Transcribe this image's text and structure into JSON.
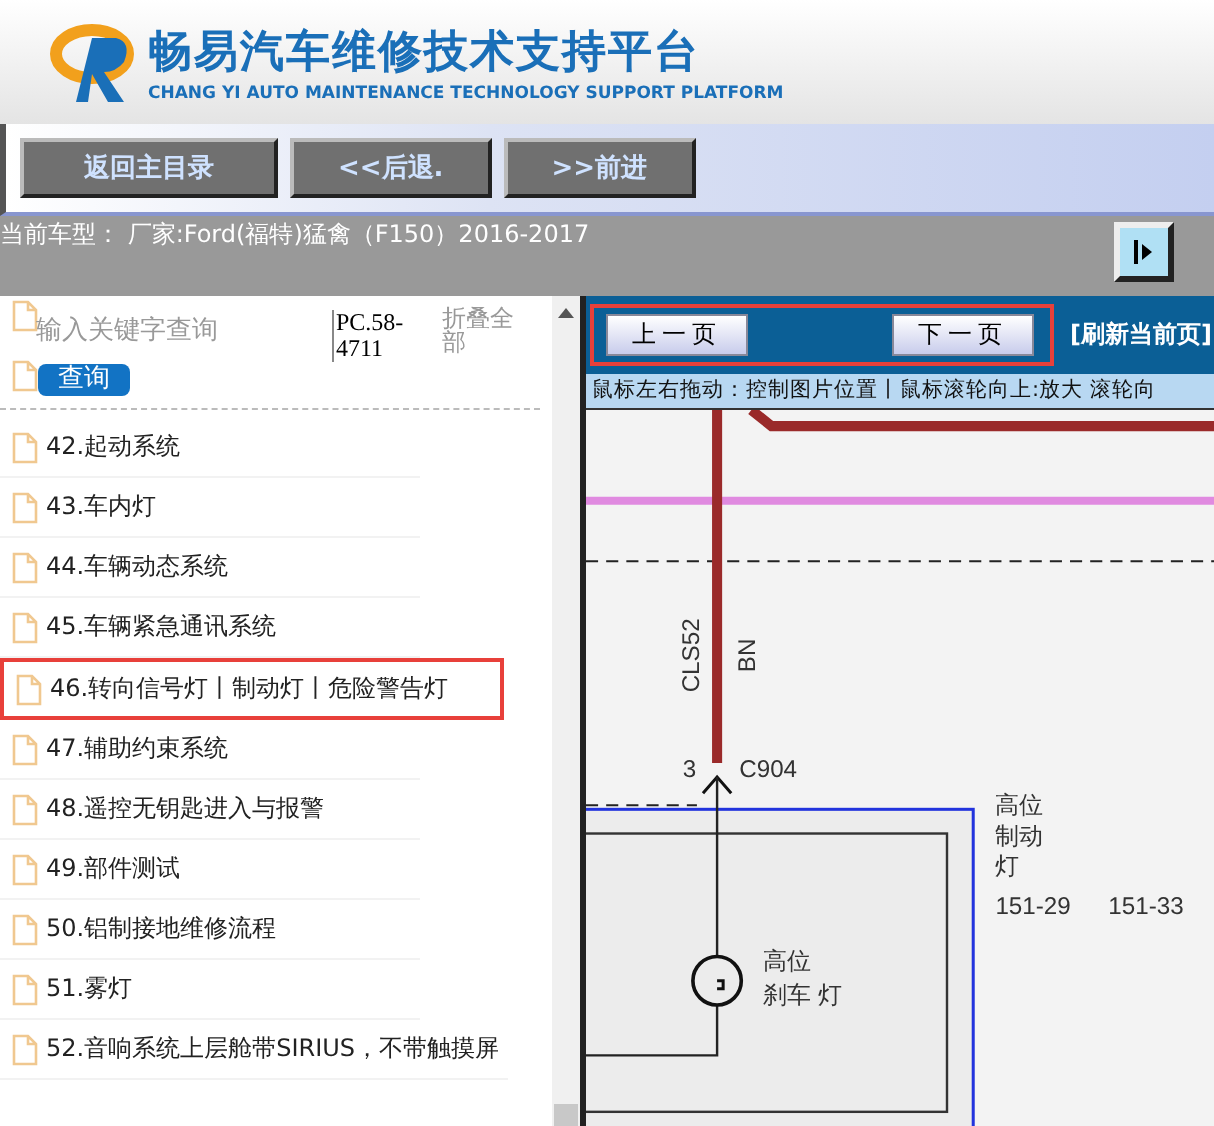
{
  "header": {
    "title": "畅易汽车维修技术支持平台",
    "subtitle": "CHANG YI AUTO MAINTENANCE TECHNOLOGY SUPPORT PLATFORM"
  },
  "nav_buttons": [
    "返回主目录",
    "<<后退.",
    ">>前进"
  ],
  "model_bar": {
    "text": "当前车型： 厂家:Ford(福特)猛禽（F150）2016-2017"
  },
  "sidebar": {
    "search": {
      "placeholder": "输入关键字查询",
      "button": "查询"
    },
    "code": "PC.58-4711",
    "collapse": "折叠全部",
    "items": [
      {
        "label": "42.起动系统",
        "highlighted": false
      },
      {
        "label": "43.车内灯",
        "highlighted": false
      },
      {
        "label": "44.车辆动态系统",
        "highlighted": false
      },
      {
        "label": "45.车辆紧急通讯系统",
        "highlighted": false
      },
      {
        "label": "46.转向信号灯丨制动灯丨危险警告灯",
        "highlighted": true
      },
      {
        "label": "47.辅助约束系统",
        "highlighted": false
      },
      {
        "label": "48.遥控无钥匙进入与报警",
        "highlighted": false
      },
      {
        "label": "49.部件测试",
        "highlighted": false
      },
      {
        "label": "50.铝制接地维修流程",
        "highlighted": false
      },
      {
        "label": "51.雾灯",
        "highlighted": false
      },
      {
        "label": "52.音响系统上层舱带SIRIUS，不带触摸屏",
        "highlighted": false
      }
    ]
  },
  "viewer": {
    "prev": "上一页",
    "next": "下一页",
    "pager_highlighted": true,
    "refresh": "[刷新当前页]",
    "hint": "鼠标左右拖动：控制图片位置丨鼠标滚轮向上:放大  滚轮向",
    "diagram": {
      "wire_code": "CLS52",
      "wire_color": "BN",
      "pin": "3",
      "connector": "C904",
      "component_lines": [
        "高位",
        "制动",
        "灯"
      ],
      "refs": [
        "151-29",
        "151-33"
      ],
      "lamp_lines": [
        "高位",
        "刹车 灯"
      ]
    }
  }
}
